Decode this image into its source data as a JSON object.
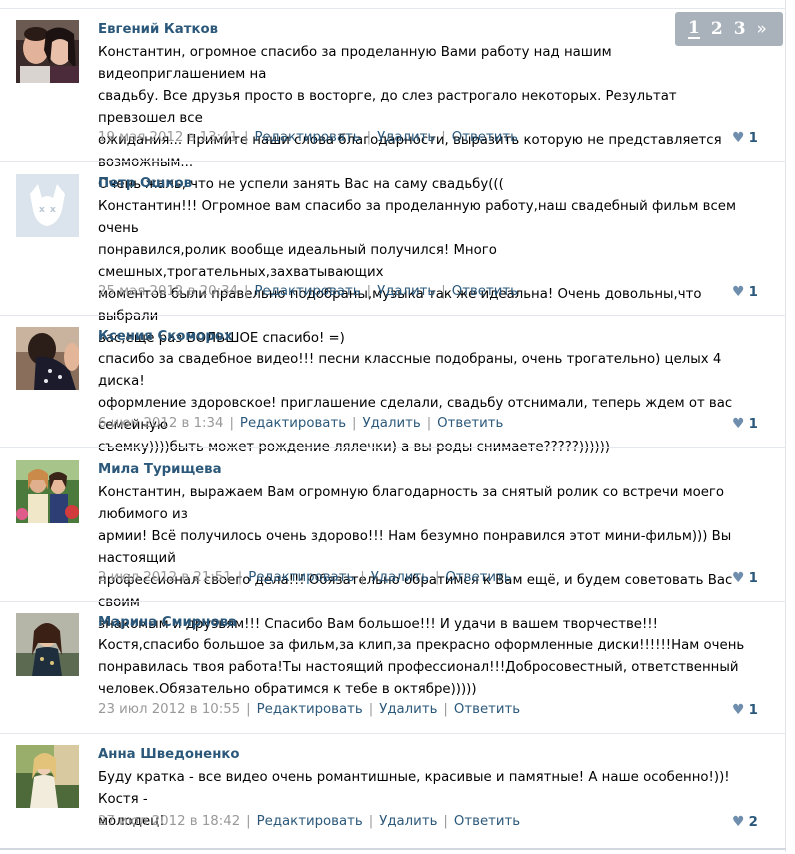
{
  "pagination": {
    "pages": [
      "1",
      "2",
      "3"
    ],
    "current": "1",
    "next": "»"
  },
  "posts": [
    {
      "author": "Евгений Катков",
      "lines": [
        "Константин, огромное спасибо за проделанную Вами работу над нашим видеоприглашением на",
        "свадьбу. Все друзья просто в восторге, до слез растрогало некоторых. Результат превзошел все",
        "ожидания... Примите наши слова благодарности, выразить которую не представляется возможным...",
        "Очень жаль, что не успели занять Вас на саму свадьбу((("
      ],
      "date": "19 мая 2012 в 13:41",
      "edit": "Редактировать",
      "delete": "Удалить",
      "reply": "Ответить",
      "likes": "1"
    },
    {
      "author": "Петр Ошков",
      "lines": [
        "Константин!!! Огромное вам спасибо за проделанную работу,наш свадебный фильм всем очень",
        "понравился,ролик вообще идеальный получился! Много смешных,трогательных,захватывающих",
        "моментов были правельно подобраны,музыка так же идеальна! Очень довольны,что выбрали",
        "вас,еще раз БОЛЬШОЕ спасибо! =)"
      ],
      "date": "25 мая 2012 в 20:34",
      "edit": "Редактировать",
      "delete": "Удалить",
      "reply": "Ответить",
      "likes": "1"
    },
    {
      "author": "Ксения Скоморох",
      "lines": [
        "спасибо за свадебное видео!!! песни классные подобраны, очень трогательно) целых 4 диска!",
        "оформление здоровское! приглашение сделали, свадьбу отснимали, теперь ждем от вас семейную",
        "съемку))))быть может рождение лялечки) а вы роды снимаете?????))))))"
      ],
      "date": "6 июн 2012 в 1:34",
      "edit": "Редактировать",
      "delete": "Удалить",
      "reply": "Ответить",
      "likes": "1"
    },
    {
      "author": "Мила Турищева",
      "lines": [
        "Константин, выражаем Вам огромную благодарность за снятый ролик со встречи моего любимого из",
        "армии! Всё получилось очень здорово!!! Нам безумно понравился этот мини-фильм))) Вы настоящий",
        "профессионал своего дела!!! Обязательно обратимся к Вам ещё, и будем советовать Вас своим",
        "знакомым и друзьям!!! Спасибо Вам большое!!! И удачи в вашем творчестве!!!"
      ],
      "date": "2 июл 2012 в 21:51",
      "edit": "Редактировать",
      "delete": "Удалить",
      "reply": "Ответить",
      "likes": "1"
    },
    {
      "author": "Марина Смирнова",
      "lines": [
        "Костя,спасибо большое за фильм,за клип,за прекрасно оформленные диски!!!!!!Нам очень",
        "понравилась твоя работа!Ты настоящий профессионал!!!Добросовестный, ответственный",
        "человек.Обязательно обратимся к тебе в октябре)))))"
      ],
      "date": "23 июл 2012 в 10:55",
      "edit": "Редактировать",
      "delete": "Удалить",
      "reply": "Ответить",
      "likes": "1"
    },
    {
      "author": "Анна Шведоненко",
      "lines": [
        "Буду кратка - все видео очень романтишные, красивые и памятные! А наше особенно!))! Костя -",
        "молодец!"
      ],
      "date": "27 июл 2012 в 18:42",
      "edit": "Редактировать",
      "delete": "Удалить",
      "reply": "Ответить",
      "likes": "2"
    }
  ]
}
